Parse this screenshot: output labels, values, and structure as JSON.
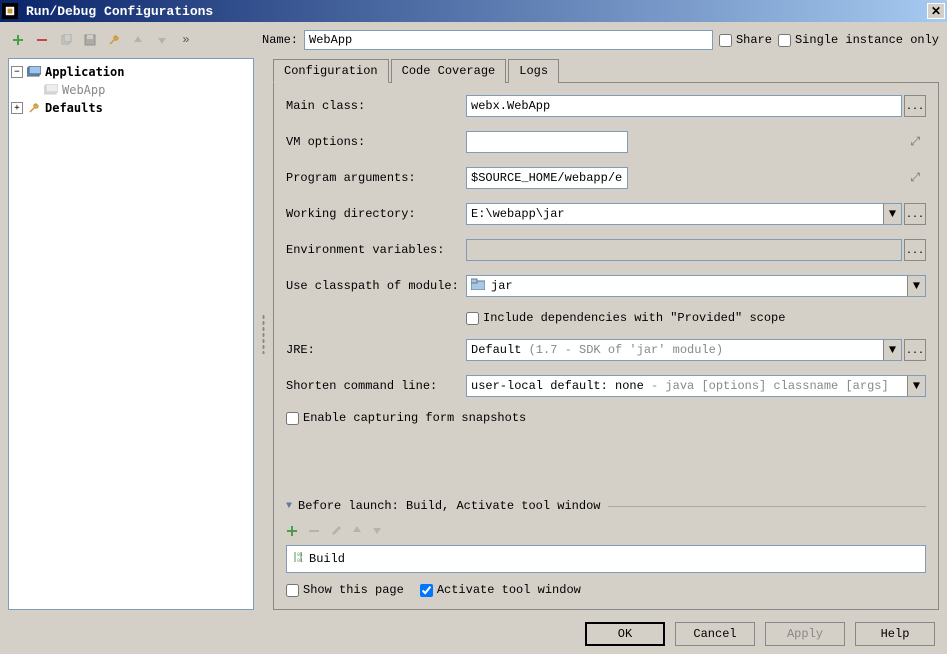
{
  "titlebar": {
    "title": "Run/Debug Configurations"
  },
  "name_label": "Name:",
  "name_value": "WebApp",
  "share_label": "Share",
  "single_instance_label": "Single instance only",
  "tree": {
    "application": "Application",
    "webapp": "WebApp",
    "defaults": "Defaults"
  },
  "tabs": {
    "configuration": "Configuration",
    "code_coverage": "Code Coverage",
    "logs": "Logs"
  },
  "form": {
    "main_class_label": "Main class:",
    "main_class_value": "webx.WebApp",
    "vm_options_label": "VM options:",
    "vm_options_value": "",
    "program_args_label": "Program arguments:",
    "program_args_value": "$SOURCE_HOME/webapp/etc/config.lua -l",
    "working_dir_label": "Working directory:",
    "working_dir_value": "E:\\webapp\\jar",
    "env_vars_label": "Environment variables:",
    "env_vars_value": "",
    "classpath_label": "Use classpath of module:",
    "classpath_value": "jar",
    "include_deps_label": "Include dependencies with \"Provided\" scope",
    "jre_label": "JRE:",
    "jre_value_prefix": "Default ",
    "jre_value_suffix": "(1.7 - SDK of 'jar' module)",
    "shorten_label": "Shorten command line:",
    "shorten_value_prefix": "user-local default: none ",
    "shorten_value_suffix": "- java [options] classname [args]",
    "enable_capturing_label": "Enable capturing form snapshots"
  },
  "before_launch": {
    "title": "Before launch: Build, Activate tool window",
    "build": "Build",
    "show_page": "Show this page",
    "activate_window": "Activate tool window"
  },
  "buttons": {
    "ok": "OK",
    "cancel": "Cancel",
    "apply": "Apply",
    "help": "Help"
  }
}
